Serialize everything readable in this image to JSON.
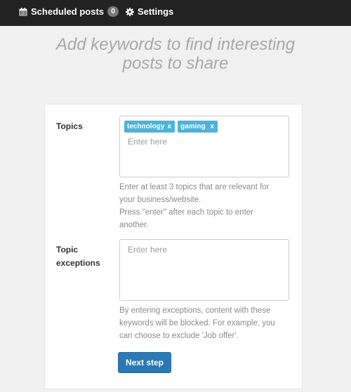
{
  "nav": {
    "scheduled_label": "Scheduled posts",
    "scheduled_count": "0",
    "settings_label": "Settings"
  },
  "headline": {
    "line1": "Add keywords to find interesting",
    "line2": "posts to share"
  },
  "topics": {
    "label": "Topics",
    "tags": [
      {
        "label": "technology",
        "remove": "x"
      },
      {
        "label": "gaming",
        "remove": "x"
      }
    ],
    "placeholder": "Enter here",
    "help_line1": "Enter at least 3 topics that are relevant for",
    "help_line2": "your business/website.",
    "help_line3": "Press \"enter\" after each topic to enter",
    "help_line4": "another."
  },
  "exceptions": {
    "label_line1": "Topic",
    "label_line2": "exceptions",
    "placeholder": "Enter here",
    "help_line1": "By entering exceptions, content with these",
    "help_line2": "keywords will be blocked. For example, you",
    "help_line3": "can choose to exclude 'Job offer'."
  },
  "actions": {
    "next_label": "Next step"
  },
  "colors": {
    "nav_bg": "#222222",
    "tag_bg": "#4cb3d9",
    "button_bg": "#2a79b4"
  }
}
